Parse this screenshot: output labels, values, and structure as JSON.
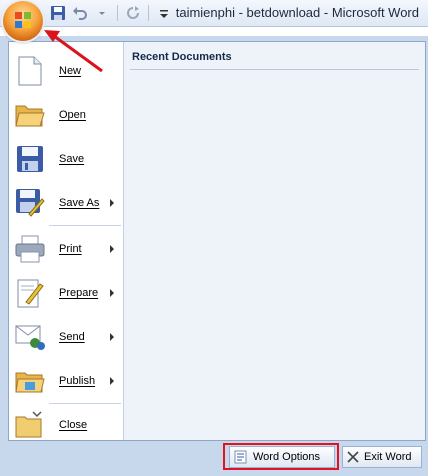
{
  "window": {
    "title": "taimienphi - betdownload - Microsoft Word"
  },
  "quick_access": {
    "items": [
      "save-icon",
      "undo-icon",
      "redo-icon",
      "customize-icon"
    ]
  },
  "menu": {
    "items": [
      {
        "label": "New",
        "icon": "new-document-icon",
        "submenu": false
      },
      {
        "label": "Open",
        "icon": "open-folder-icon",
        "submenu": false
      },
      {
        "label": "Save",
        "icon": "save-icon",
        "submenu": false
      },
      {
        "label": "Save As",
        "icon": "save-as-icon",
        "submenu": true
      },
      {
        "label": "Print",
        "icon": "printer-icon",
        "submenu": true
      },
      {
        "label": "Prepare",
        "icon": "prepare-icon",
        "submenu": true
      },
      {
        "label": "Send",
        "icon": "send-icon",
        "submenu": true
      },
      {
        "label": "Publish",
        "icon": "publish-icon",
        "submenu": true
      },
      {
        "label": "Close",
        "icon": "close-folder-icon",
        "submenu": false
      }
    ]
  },
  "recent": {
    "title": "Recent Documents"
  },
  "footer": {
    "word_options_label": "Word Options",
    "exit_label": "Exit Word"
  },
  "colors": {
    "highlight": "#e2121f",
    "menu_background": "#c7d7ec",
    "panel_background": "#eef3fa"
  }
}
